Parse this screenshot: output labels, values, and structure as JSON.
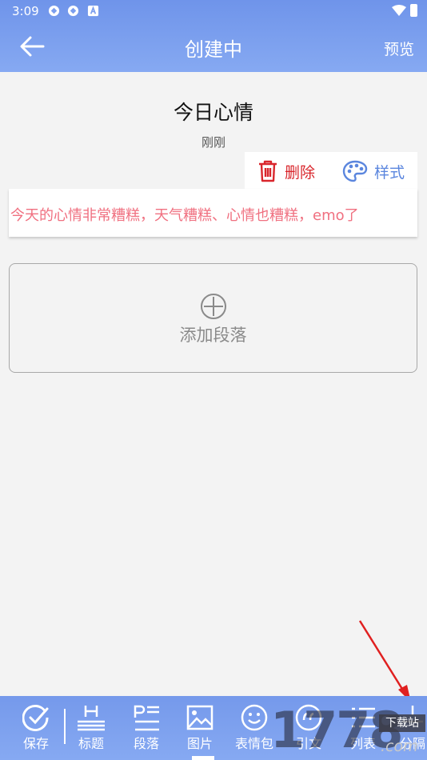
{
  "status_bar": {
    "time": "3:09"
  },
  "header": {
    "title": "创建中",
    "preview_label": "预览"
  },
  "document": {
    "title": "今日心情",
    "timestamp": "刚刚"
  },
  "paragraph_actions": {
    "delete_label": "删除",
    "style_label": "样式"
  },
  "paragraph": {
    "text": "今天的心情非常糟糕，天气糟糕、心情也糟糕，emo了"
  },
  "add_paragraph": {
    "label": "添加段落"
  },
  "toolbar": {
    "items": [
      {
        "label": "保存",
        "icon": "check-circle-icon"
      },
      {
        "label": "标题",
        "icon": "heading-icon"
      },
      {
        "label": "段落",
        "icon": "paragraph-icon"
      },
      {
        "label": "图片",
        "icon": "image-icon"
      },
      {
        "label": "表情包",
        "icon": "emoji-icon"
      },
      {
        "label": "引文",
        "icon": "quote-icon"
      },
      {
        "label": "列表",
        "icon": "list-icon"
      },
      {
        "label": "分隔",
        "icon": "divider-icon"
      }
    ]
  },
  "watermark": {
    "brand": "1778",
    "tag": "下载站",
    "domain": ".com"
  },
  "colors": {
    "header_gradient_top": "#6f94ea",
    "header_gradient_bottom": "#86a9f2",
    "delete_red": "#d9262c",
    "style_blue": "#5b86de",
    "paragraph_text": "#f07080",
    "annotation_arrow": "#e02020"
  }
}
